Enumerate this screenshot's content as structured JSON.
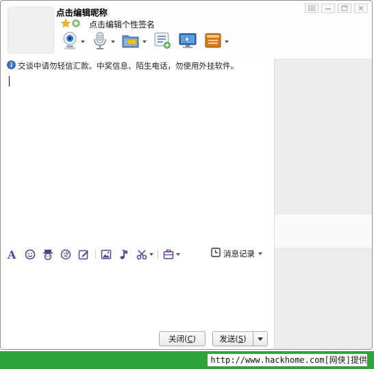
{
  "header": {
    "nickname": "点击编辑昵称",
    "signature": "点击编辑个性签名"
  },
  "toolbar": {
    "tools": [
      {
        "name": "video-call",
        "icon": "webcam-icon"
      },
      {
        "name": "voice-call",
        "icon": "microphone-icon"
      },
      {
        "name": "send-file",
        "icon": "folder-transfer-icon"
      },
      {
        "name": "multi-chat",
        "icon": "message-list-icon"
      },
      {
        "name": "remote-assist",
        "icon": "monitor-cursor-icon"
      },
      {
        "name": "app-box",
        "icon": "app-box-icon"
      }
    ]
  },
  "chat": {
    "notice": "交谈中请勿轻信汇款、中奖信息、陌生电话，勿使用外挂软件。"
  },
  "format_bar": {
    "history_label": "消息记录"
  },
  "buttons": {
    "close_label": "关闭(",
    "close_key": "C",
    "send_label": "发送(",
    "send_key": "S",
    "paren_close": ")"
  },
  "footer": {
    "text": "http://www.hackhome.com[网侠]提供"
  },
  "colors": {
    "accent_purple": "#5b3f8c",
    "footer_green": "#2da33a"
  }
}
